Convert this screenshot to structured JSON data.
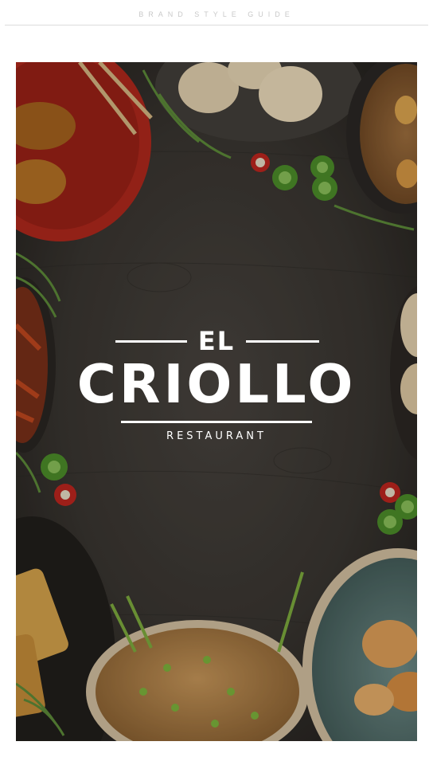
{
  "header": {
    "label": "BRAND STYLE GUIDE"
  },
  "logo": {
    "line1": "EL",
    "line2": "CRIOLLO",
    "line3": "RESTAURANT"
  },
  "colors": {
    "background": "#ffffff",
    "table_wood": "#3a3631",
    "logo_text": "#ffffff"
  }
}
